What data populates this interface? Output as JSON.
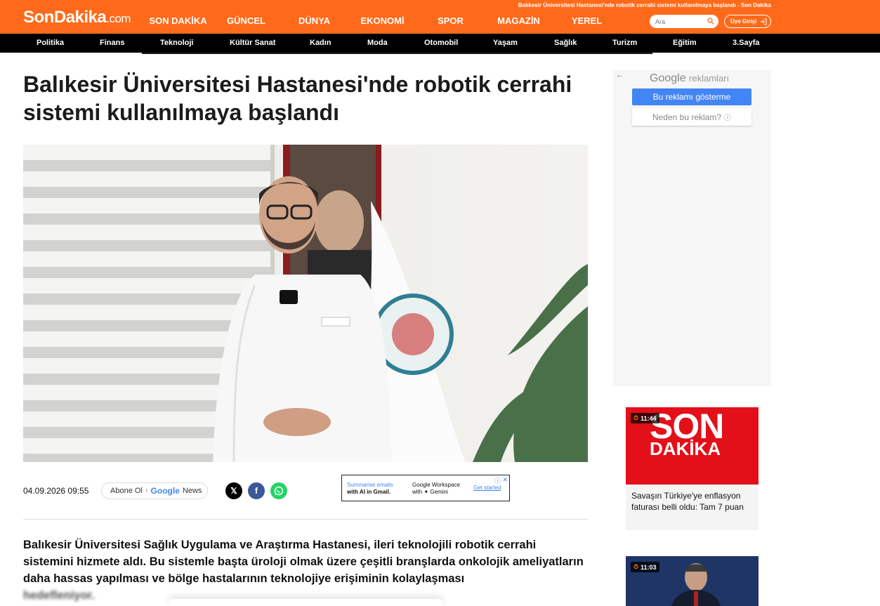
{
  "header": {
    "logo_main": "SonDakika",
    "logo_domain": ".com",
    "top_title": "Balıkesir Üniversitesi Hastanesi'nde robotik cerrahi sistemi kullanılmaya başlandı - Son Dakika",
    "main_nav": [
      "SON DAKİKA",
      "GÜNCEL",
      "DÜNYA",
      "EKONOMİ",
      "SPOR",
      "MAGAZİN",
      "YEREL"
    ],
    "search_placeholder": "Ara",
    "login_label": "Üye Girişi",
    "brand_color": "#ff6a1a"
  },
  "category_nav": [
    "Politika",
    "Finans",
    "Teknoloji",
    "Kültür Sanat",
    "Kadın",
    "Moda",
    "Otomobil",
    "Yaşam",
    "Sağlık",
    "Turizm",
    "Eğitim",
    "3.Sayfa"
  ],
  "article": {
    "headline": "Balıkesir Üniversitesi Hastanesi'nde robotik cerrahi sistemi kullanılmaya başlandı",
    "date": "04.09.2026 09:55",
    "google_news_prefix": "Abone Ol",
    "google_news_brand": "Google",
    "google_news_suffix": "News",
    "share_icons": [
      "x-icon",
      "facebook-icon",
      "whatsapp-icon"
    ],
    "summary_visible": "Balıkesir Üniversitesi Sağlık Uygulama ve Araştırma Hastanesi, ileri teknolojili robotik cerrahi sistemini hizmete aldı. Bu sistemle başta üroloji olmak üzere çeşitli branşlarda onkolojik ameliyatların daha hassas yapılması ve bölge hastalarının teknolojiye erişiminin kolaylaşması",
    "summary_faded": "hedefleniyor."
  },
  "inline_ad": {
    "left_line1": "Summarise emails",
    "left_line2": "with AI in Gmail.",
    "mid_line1": "Google Workspace",
    "mid_line2": "with ✦ Gemini",
    "cta": "Get started"
  },
  "side_ad": {
    "google": "Google",
    "reklamlari": "reklamları",
    "stop_label": "Bu reklamı gösterme",
    "why_label": "Neden bu reklam?"
  },
  "side_news": [
    {
      "time": "11:44",
      "title": "Savaşın Türkiye'ye enflasyon faturası belli oldu: Tam 7 puan",
      "thumb_text_1": "SON",
      "thumb_text_2": "DAKİKA"
    },
    {
      "time": "11:03",
      "title": ""
    }
  ]
}
